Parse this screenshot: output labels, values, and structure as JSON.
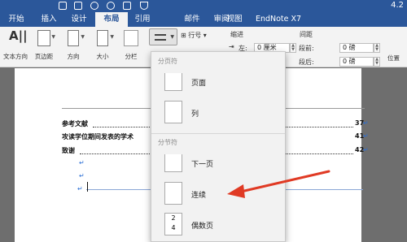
{
  "titlebar": {
    "right_text": "4.2"
  },
  "tabs": [
    "开始",
    "插入",
    "设计",
    "布局",
    "引用",
    "邮件",
    "审阅",
    "视图",
    "EndNote X7"
  ],
  "active_tab": "布局",
  "ribbon": {
    "text_direction": "文本方向",
    "margins": "页边距",
    "orientation": "方向",
    "size": "大小",
    "columns": "分栏",
    "line_numbers": "行号",
    "indent_header": "缩进",
    "spacing_header": "间距",
    "left_label": "左:",
    "left_value": "0 厘米",
    "before_label": "段前:",
    "before_value": "0 磅",
    "after_label": "段后:",
    "after_value": "0 磅",
    "position": "位置"
  },
  "document": {
    "toc": [
      {
        "text": "参考文献",
        "page": "37"
      },
      {
        "text": "攻读学位期间发表的学术",
        "page": "41"
      },
      {
        "text": "致谢",
        "page": "42"
      }
    ],
    "para_mark": "↵"
  },
  "menu": {
    "page_breaks_header": "分页符",
    "section_breaks_header": "分节符",
    "items": [
      "页面",
      "列",
      "下一页",
      "连续",
      "偶数页"
    ],
    "even_icon_nums": [
      "2",
      "4"
    ]
  },
  "colors": {
    "ribbon_blue": "#2b579a",
    "arrow_red": "#e03a24",
    "para_mark_blue": "#2b6fd6"
  }
}
